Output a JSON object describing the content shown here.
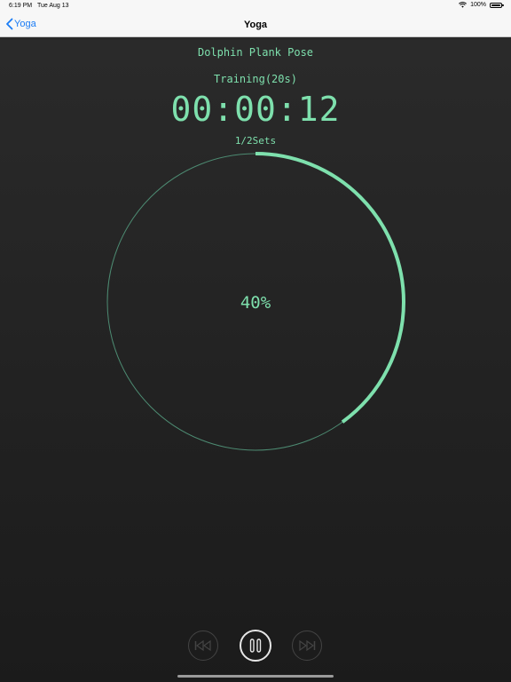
{
  "status_bar": {
    "time": "6:19 PM",
    "date": "Tue Aug 13",
    "battery": "100%",
    "icons": [
      "wifi-icon",
      "battery-icon"
    ]
  },
  "nav": {
    "back_label": "Yoga",
    "title": "Yoga"
  },
  "workout": {
    "pose": "Dolphin Plank Pose",
    "phase": "Training(20s)",
    "timer": "00:00:12",
    "sets": "1/2Sets",
    "progress_label": "40%",
    "progress": 0.4
  },
  "controls": {
    "icons": [
      "previous-icon",
      "pause-icon",
      "next-icon"
    ]
  },
  "colors": {
    "accent": "#7ee0ad",
    "ring_track": "#4d8b72",
    "nav_blue": "#1a7cf5",
    "background": "#252525"
  }
}
